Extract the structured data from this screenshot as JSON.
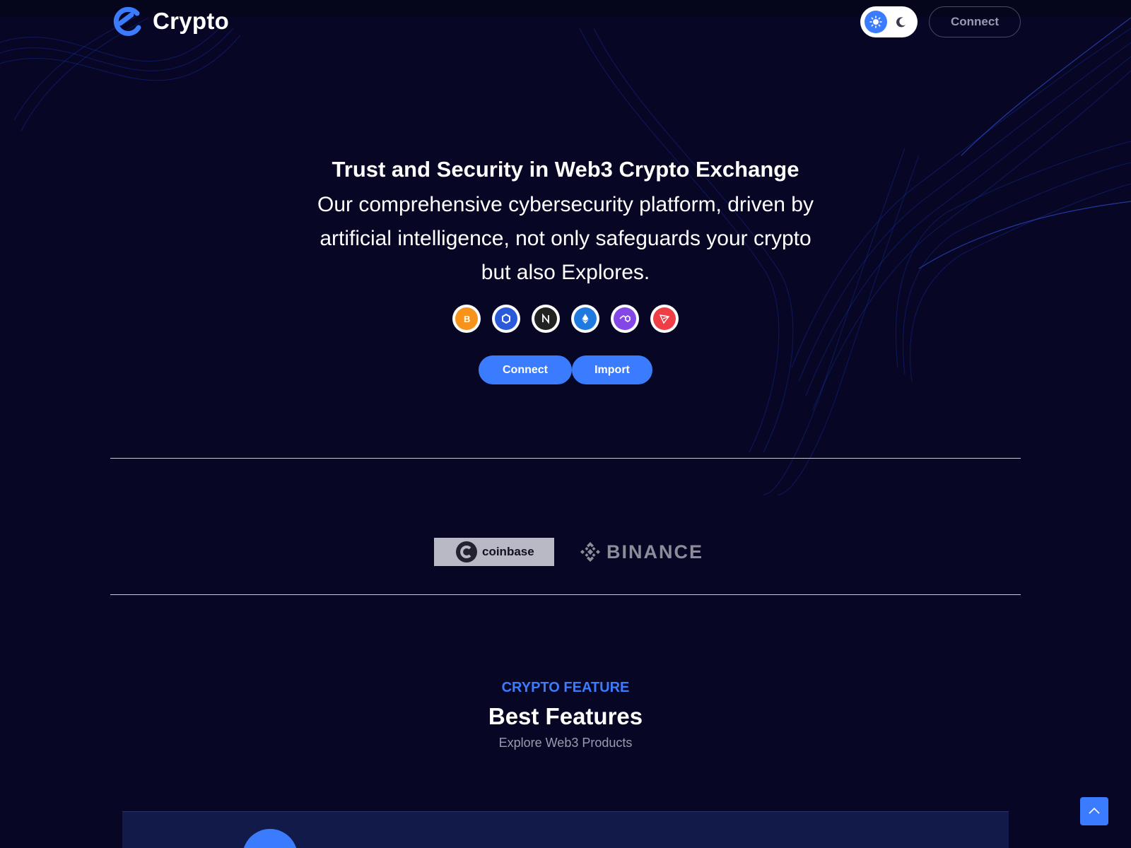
{
  "brand": {
    "name": "Crypto"
  },
  "header": {
    "connect_label": "Connect"
  },
  "hero": {
    "title": "Trust and Security in Web3 Crypto Exchange",
    "text": "Our comprehensive cybersecurity platform, driven by artificial intelligence, not only safeguards your crypto but also Explores.",
    "coins": [
      {
        "name": "bitcoin",
        "color": "#f7931a"
      },
      {
        "name": "chainlink",
        "color": "#2a5ada"
      },
      {
        "name": "near",
        "color": "#222222"
      },
      {
        "name": "ethereum",
        "color": "#1f7ae0"
      },
      {
        "name": "polygon",
        "color": "#8247e5"
      },
      {
        "name": "tron",
        "color": "#ef3e46"
      }
    ],
    "connect_label": "Connect",
    "import_label": "Import"
  },
  "partners": {
    "coinbase": "coinbase",
    "binance": "BINANCE"
  },
  "features": {
    "eyebrow": "CRYPTO FEATURE",
    "title": "Best Features",
    "subtitle": "Explore Web3 Products"
  },
  "colors": {
    "accent": "#3b7cff",
    "background": "#070725"
  }
}
